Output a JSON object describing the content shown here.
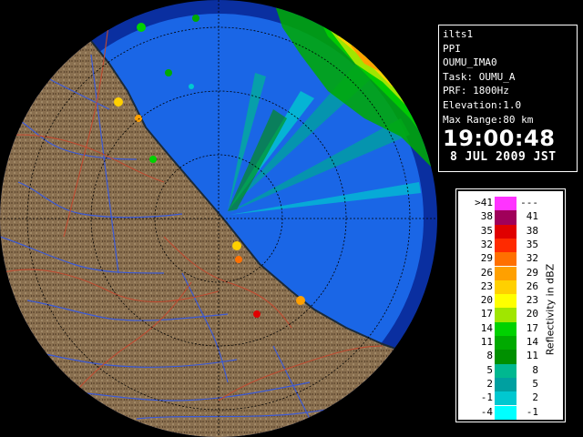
{
  "info": {
    "lines": [
      "ilts1",
      "PPI",
      "OUMU_IMA0",
      "Task: OUMU_A",
      "PRF: 1800Hz",
      "Elevation:1.0",
      "Max Range:80 km"
    ],
    "time": "19:00:48",
    "date": "8 JUL 2009 JST"
  },
  "legend": {
    "unit": "Reflectivity in dBZ",
    "rows": [
      {
        "low": ">41",
        "high": "---",
        "color": "#ff33ff"
      },
      {
        "low": "38",
        "high": "41",
        "color": "#a0005a"
      },
      {
        "low": "35",
        "high": "38",
        "color": "#e00000"
      },
      {
        "low": "32",
        "high": "35",
        "color": "#ff2a00"
      },
      {
        "low": "29",
        "high": "32",
        "color": "#ff7000"
      },
      {
        "low": "26",
        "high": "29",
        "color": "#ffa000"
      },
      {
        "low": "23",
        "high": "26",
        "color": "#ffd000"
      },
      {
        "low": "20",
        "high": "23",
        "color": "#ffff00"
      },
      {
        "low": "17",
        "high": "20",
        "color": "#a0e600"
      },
      {
        "low": "14",
        "high": "17",
        "color": "#00d200"
      },
      {
        "low": "11",
        "high": "14",
        "color": "#00aa00"
      },
      {
        "low": "8",
        "high": "11",
        "color": "#009000"
      },
      {
        "low": "5",
        "high": "8",
        "color": "#00b890"
      },
      {
        "low": "2",
        "high": "5",
        "color": "#00a0a0"
      },
      {
        "low": "-1",
        "high": "2",
        "color": "#00c8d0"
      },
      {
        "low": "-4",
        "high": "-1",
        "color": "#00ffff"
      }
    ]
  },
  "colors": {
    "sea": "#1a66e6",
    "beyond_range": "#0a2fa0",
    "land": "#8a7050",
    "rivers": "#3b5ad8",
    "boundaries": "#c04a30",
    "range_rings": "#000000"
  }
}
